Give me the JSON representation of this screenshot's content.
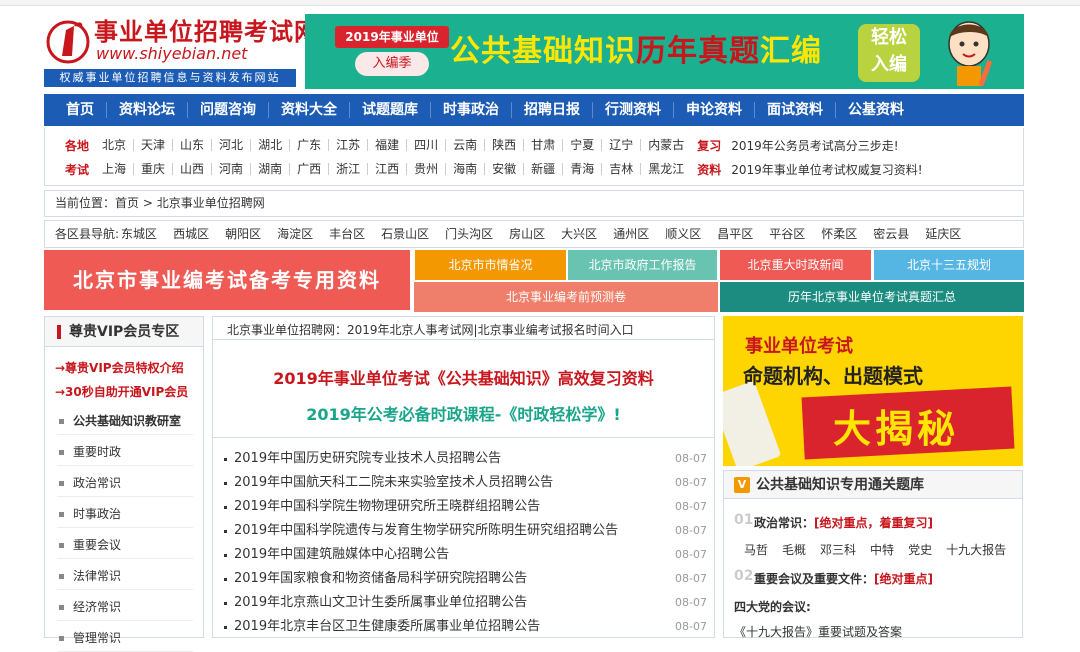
{
  "site": {
    "name": "事业单位招聘考试网",
    "domain": "www.shiyebian.net",
    "slogan": "权威事业单位招聘信息与资料发布网站"
  },
  "banner": {
    "year_tag": "2019年事业单位",
    "season": "入编季",
    "title_part1": "公共基础知识",
    "title_part2": "历年真题",
    "title_part3": "汇编",
    "easy_1": "轻松",
    "easy_2": "入编"
  },
  "nav": [
    "首页",
    "资料论坛",
    "问题咨询",
    "资料大全",
    "试题题库",
    "时事政治",
    "招聘日报",
    "行测资料",
    "申论资料",
    "面试资料",
    "公基资料"
  ],
  "regions": {
    "label_1": "各地",
    "row_1": [
      "北京",
      "天津",
      "山东",
      "河北",
      "湖北",
      "广东",
      "江苏",
      "福建",
      "四川",
      "云南",
      "陕西",
      "甘肃",
      "宁夏",
      "辽宁",
      "内蒙古"
    ],
    "key_1": "复习",
    "link_1": "2019年公务员考试高分三步走!",
    "label_2": "考试",
    "row_2": [
      "上海",
      "重庆",
      "山西",
      "河南",
      "湖南",
      "广西",
      "浙江",
      "江西",
      "贵州",
      "海南",
      "安徽",
      "新疆",
      "青海",
      "吉林",
      "黑龙江"
    ],
    "key_2": "资料",
    "link_2": "2019年事业单位考试权威复习资料!"
  },
  "breadcrumb": {
    "label": "当前位置：",
    "home": "首页",
    "sep": ">",
    "current": "北京事业单位招聘网"
  },
  "districts": {
    "label": "各区县导航:",
    "items": [
      "东城区",
      "西城区",
      "朝阳区",
      "海淀区",
      "丰台区",
      "石景山区",
      "门头沟区",
      "房山区",
      "大兴区",
      "通州区",
      "顺义区",
      "昌平区",
      "平谷区",
      "怀柔区",
      "密云县",
      "延庆区"
    ]
  },
  "promo": {
    "left_title": "北京市事业编考试备考专用资料",
    "buttons": [
      {
        "label": "北京市市情省况",
        "color": "#f39800"
      },
      {
        "label": "北京市政府工作报告",
        "color": "#69c3b1"
      },
      {
        "label": "北京重大时政新闻",
        "color": "#ef5a55"
      },
      {
        "label": "北京十三五规划",
        "color": "#56b6e3"
      },
      {
        "label": "北京事业编考前预测卷",
        "color": "#ef7f6a"
      },
      {
        "label": "历年北京事业单位考试真题汇总",
        "color": "#1d8c80"
      }
    ]
  },
  "sidebar": {
    "title": "尊贵VIP会员专区",
    "vip_links": [
      "→尊贵VIP会员特权介绍",
      "→30秒自助开通VIP会员"
    ],
    "categories": [
      "公共基础知识教研室",
      "重要时政",
      "政治常识",
      "时事政治",
      "重要会议",
      "法律常识",
      "经济常识",
      "管理常识"
    ]
  },
  "middle": {
    "marquee": "北京事业单位招聘网：2019年北京人事考试网|北京事业编考试报名时间入口",
    "headline_1": "2019年事业单位考试《公共基础知识》高效复习资料",
    "headline_2": "2019年公考必备时政课程-《时政轻松学》!",
    "news": [
      {
        "title": "2019年中国历史研究院专业技术人员招聘公告",
        "date": "08-07"
      },
      {
        "title": "2019年中国航天科工二院未来实验室技术人员招聘公告",
        "date": "08-07"
      },
      {
        "title": "2019年中国科学院生物物理研究所王晓群组招聘公告",
        "date": "08-07"
      },
      {
        "title": "2019年中国科学院遗传与发育生物学研究所陈明生研究组招聘公告",
        "date": "08-07"
      },
      {
        "title": "2019年中国建筑融媒体中心招聘公告",
        "date": "08-07"
      },
      {
        "title": "2019年国家粮食和物资储备局科学研究院招聘公告",
        "date": "08-07"
      },
      {
        "title": "2019年北京燕山文卫计生委所属事业单位招聘公告",
        "date": "08-07"
      },
      {
        "title": "2019年北京丰台区卫生健康委所属事业单位招聘公告",
        "date": "08-07"
      }
    ]
  },
  "right_ad": {
    "line_1": "事业单位考试",
    "line_2": "命题机构、出题模式",
    "big": "大揭秘"
  },
  "right_box": {
    "icon": "V",
    "title": "公共基础知识专用通关题库",
    "q1_num": "01",
    "q1_label": "政治常识：",
    "q1_key": "[绝对重点，着重复习]",
    "q1_tags": [
      "马哲",
      "毛概",
      "邓三科",
      "中特",
      "党史",
      "十九大报告"
    ],
    "q2_num": "02",
    "q2_label": "重要会议及重要文件：",
    "q2_key": "[绝对重点]",
    "plain": "四大党的会议:",
    "link": "《十九大报告》重要试题及答案"
  }
}
